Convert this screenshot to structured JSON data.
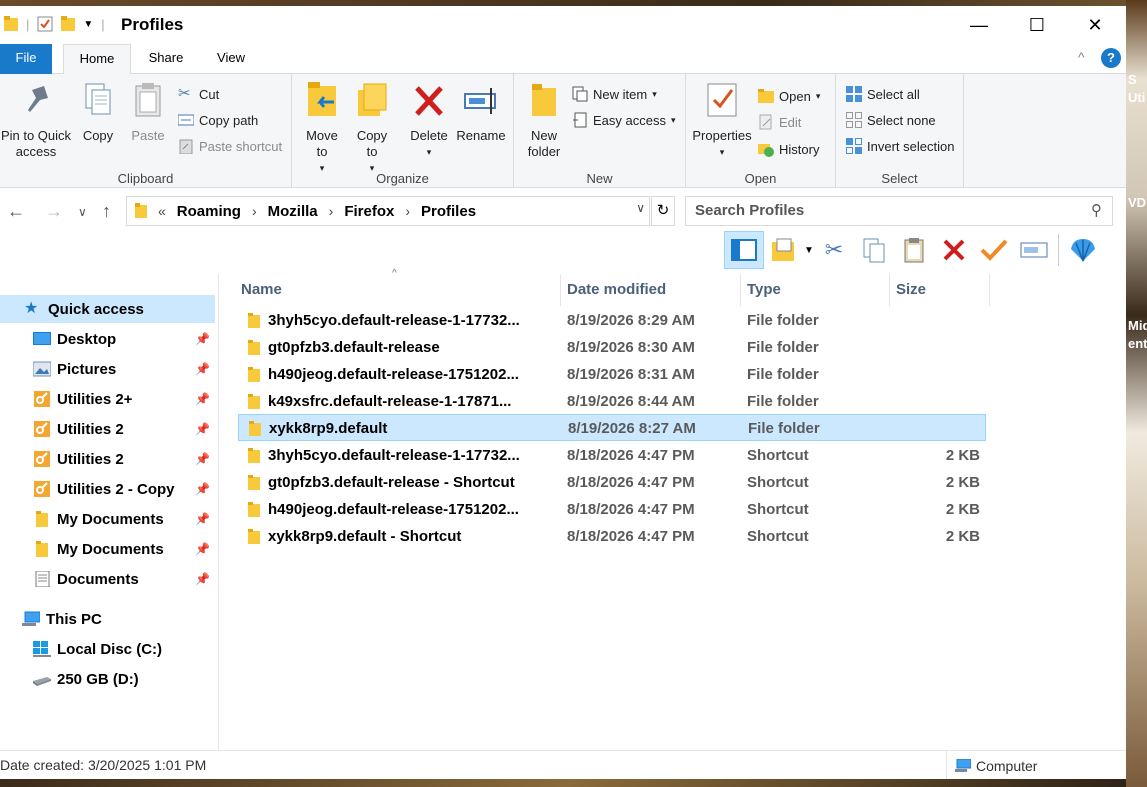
{
  "window": {
    "title": "Profiles",
    "minimize": "—",
    "maximize": "☐",
    "close": "✕"
  },
  "tabs": [
    "File",
    "Home",
    "Share",
    "View"
  ],
  "ribbon": {
    "clipboard": {
      "label": "Clipboard",
      "pin": "Pin to Quick access",
      "copy": "Copy",
      "paste": "Paste",
      "cut": "Cut",
      "copy_path": "Copy path",
      "paste_shortcut": "Paste shortcut"
    },
    "organize": {
      "label": "Organize",
      "move_to": "Move to",
      "copy_to": "Copy to",
      "delete": "Delete",
      "rename": "Rename"
    },
    "new": {
      "label": "New",
      "new_folder": "New folder",
      "new_item": "New item",
      "easy_access": "Easy access"
    },
    "open": {
      "label": "Open",
      "properties": "Properties",
      "open": "Open",
      "edit": "Edit",
      "history": "History"
    },
    "select": {
      "label": "Select",
      "select_all": "Select all",
      "select_none": "Select none",
      "invert": "Invert selection"
    }
  },
  "address": {
    "overflow": "«",
    "crumbs": [
      "Roaming",
      "Mozilla",
      "Firefox",
      "Profiles"
    ],
    "search_placeholder": "Search Profiles"
  },
  "nav": {
    "quick_access": "Quick access",
    "items": [
      {
        "label": "Desktop",
        "icon": "desktop-icon"
      },
      {
        "label": "Pictures",
        "icon": "pictures-icon"
      },
      {
        "label": "Utilities 2+",
        "icon": "shortcut-icon"
      },
      {
        "label": "Utilities 2",
        "icon": "shortcut-icon"
      },
      {
        "label": "Utilities 2",
        "icon": "shortcut-icon"
      },
      {
        "label": "Utilities 2 - Copy",
        "icon": "shortcut-icon"
      },
      {
        "label": "My Documents",
        "icon": "folder-icon"
      },
      {
        "label": "My Documents",
        "icon": "folder-icon"
      },
      {
        "label": "Documents",
        "icon": "documents-icon"
      }
    ],
    "this_pc": "This PC",
    "drives": [
      "Local Disc (C:)",
      "250 GB (D:)"
    ]
  },
  "columns": [
    "Name",
    "Date modified",
    "Type",
    "Size"
  ],
  "files": [
    {
      "name": "3hyh5cyo.default-release-1-17732...",
      "date": "8/19/2026 8:29 AM",
      "type": "File folder",
      "size": ""
    },
    {
      "name": "gt0pfzb3.default-release",
      "date": "8/19/2026 8:30 AM",
      "type": "File folder",
      "size": ""
    },
    {
      "name": "h490jeog.default-release-1751202...",
      "date": "8/19/2026 8:31 AM",
      "type": "File folder",
      "size": ""
    },
    {
      "name": "k49xsfrc.default-release-1-17871...",
      "date": "8/19/2026 8:44 AM",
      "type": "File folder",
      "size": ""
    },
    {
      "name": "xykk8rp9.default",
      "date": "8/19/2026 8:27 AM",
      "type": "File folder",
      "size": ""
    },
    {
      "name": "3hyh5cyo.default-release-1-17732...",
      "date": "8/18/2026 4:47 PM",
      "type": "Shortcut",
      "size": "2 KB"
    },
    {
      "name": "gt0pfzb3.default-release - Shortcut",
      "date": "8/18/2026 4:47 PM",
      "type": "Shortcut",
      "size": "2 KB"
    },
    {
      "name": "h490jeog.default-release-1751202...",
      "date": "8/18/2026 4:47 PM",
      "type": "Shortcut",
      "size": "2 KB"
    },
    {
      "name": "xykk8rp9.default - Shortcut",
      "date": "8/18/2026 4:47 PM",
      "type": "Shortcut",
      "size": "2 KB"
    }
  ],
  "status": {
    "left": "Date created: 3/20/2025 1:01 PM",
    "right": "Computer"
  },
  "desktop_strip": [
    "S",
    "Uti",
    "VD",
    "Mid",
    "ente"
  ],
  "colors": {
    "accent": "#1979ca",
    "selection": "#cce8ff",
    "folder": "#f8c93a",
    "delete_red": "#d01e1e"
  }
}
